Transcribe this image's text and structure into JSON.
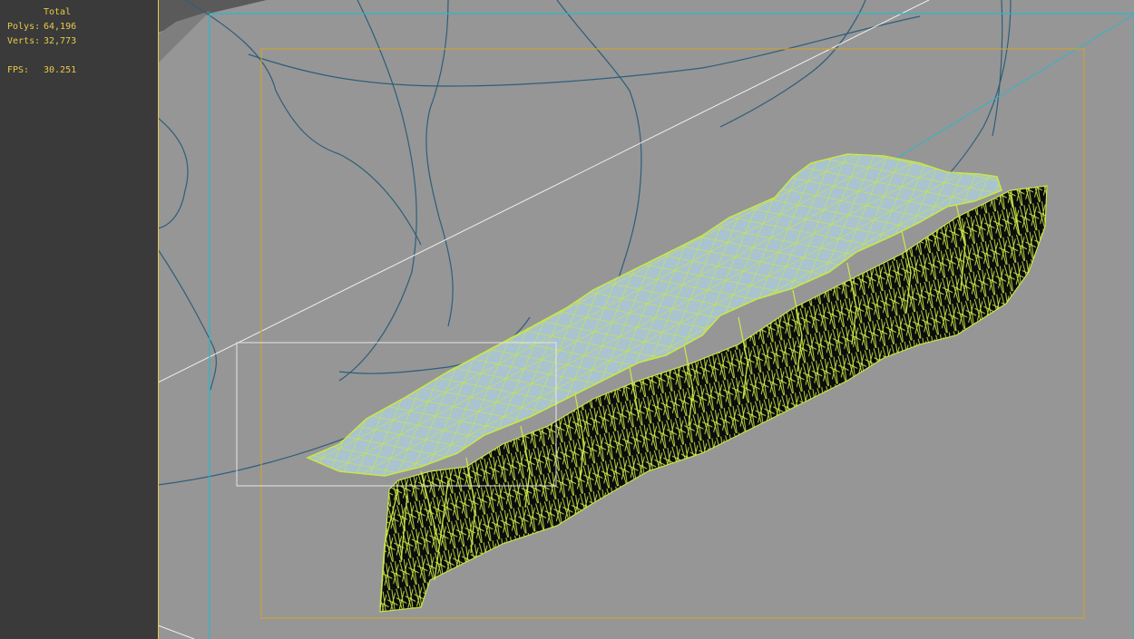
{
  "stats": {
    "title": "Total",
    "polys_label": "Polys:",
    "polys_value": "64,196",
    "verts_label": "Verts:",
    "verts_value": "32,773",
    "fps_label": "FPS:",
    "fps_value": "30.251"
  },
  "colors": {
    "panel_bg": "#3a3a3a",
    "viewport_bg": "#969696",
    "stats_text": "#e8c948",
    "wireframe": "#c8e648",
    "mesh_top": "#a9c3cf",
    "mesh_side": "#0c0c0c",
    "spline": "#2e5e7a",
    "safe_frame_outer": "#2ab8cc",
    "safe_frame_inner": "#c8a23a",
    "selection_box": "#e6e6e6"
  }
}
